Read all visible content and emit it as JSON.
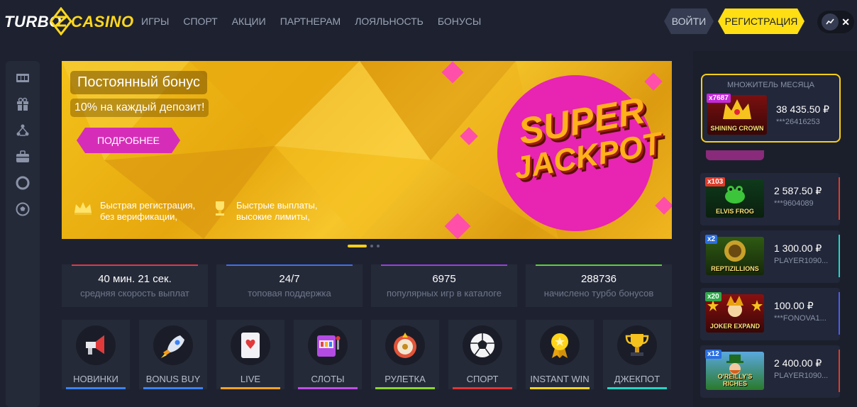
{
  "header": {
    "logo_left": "TURBO",
    "logo_right": "CASINO",
    "nav": [
      "ИГРЫ",
      "СПОРТ",
      "АКЦИИ",
      "ПАРТНЕРАМ",
      "ЛОЯЛЬНОСТЬ",
      "БОНУСЫ"
    ],
    "login_label": "ВОЙТИ",
    "register_label": "РЕГИСТРАЦИЯ",
    "close_glyph": "✕"
  },
  "sidebar": {
    "icons": [
      "slots-icon",
      "gift-icon",
      "tournament-icon",
      "briefcase-icon",
      "lifebuoy-icon",
      "soccer-ball-icon"
    ]
  },
  "banner": {
    "title": "Постоянный бонус",
    "subtitle": "10% на каждый депозит!",
    "button": "ПОДРОБНЕЕ",
    "feature1_l1": "Быстрая регистрация,",
    "feature1_l2": "без верификации,",
    "feature2_l1": "Быстрые выплаты,",
    "feature2_l2": "высокие лимиты,",
    "jackpot_l1": "SUPER",
    "jackpot_l2": "JACKPOT",
    "slides_total": 3,
    "slide_active": 1
  },
  "stats": [
    {
      "value": "40 мин. 21 сек.",
      "desc": "средняя скорость выплат",
      "color": "#e0394a"
    },
    {
      "value": "24/7",
      "desc": "топовая поддержка",
      "color": "#3f6ef0"
    },
    {
      "value": "6975",
      "desc": "популярных игр в каталоге",
      "color": "#9a3fe0"
    },
    {
      "value": "288736",
      "desc": "начислено турбо бонусов",
      "color": "#5bd13a"
    }
  ],
  "categories": [
    {
      "label": "НОВИНКИ",
      "icon": "megaphone-icon",
      "color": "#3b82f6"
    },
    {
      "label": "BONUS BUY",
      "icon": "rocket-icon",
      "color": "#3b82f6"
    },
    {
      "label": "LIVE",
      "icon": "playing-card-icon",
      "color": "#f6a21e"
    },
    {
      "label": "СЛОТЫ",
      "icon": "slot-machine-icon",
      "color": "#c04de8"
    },
    {
      "label": "РУЛЕТКА",
      "icon": "roulette-icon",
      "color": "#8ad629"
    },
    {
      "label": "СПОРТ",
      "icon": "soccer-ball-icon",
      "color": "#e03434"
    },
    {
      "label": "INSTANT WIN",
      "icon": "medal-icon",
      "color": "#ffd31a"
    },
    {
      "label": "ДЖЕКПОТ",
      "icon": "trophy-icon",
      "color": "#1fd6c6"
    }
  ],
  "right_panel": {
    "multiplier_header": "МНОЖИТЕЛЬ МЕСЯЦА",
    "multiplier": {
      "badge": "x7687",
      "game": "SHINING CROWN",
      "amount": "38 435.50 ₽",
      "user": "***26416253"
    },
    "wins": [
      {
        "badge": "x103",
        "game": "ELVIS FROG",
        "amount": "2 587.50 ₽",
        "user": "***9604089",
        "badge_color": "#e03a2a",
        "edge": "#e03a2a"
      },
      {
        "badge": "x2",
        "game": "REPTIZILLIONS",
        "amount": "1 300.00 ₽",
        "user": "PLAYER1090...",
        "badge_color": "#2a6ee0",
        "edge": "#1fd6c6"
      },
      {
        "badge": "x20",
        "game": "JOKER EXPAND",
        "amount": "100.00 ₽",
        "user": "***FONOVA1...",
        "badge_color": "#2fa84a",
        "edge": "#4b5cf0"
      },
      {
        "badge": "x12",
        "game": "O'REILLY'S RICHES",
        "amount": "2 400.00 ₽",
        "user": "PLAYER1090...",
        "badge_color": "#2a6ee0",
        "edge": "#e03a2a"
      }
    ]
  }
}
